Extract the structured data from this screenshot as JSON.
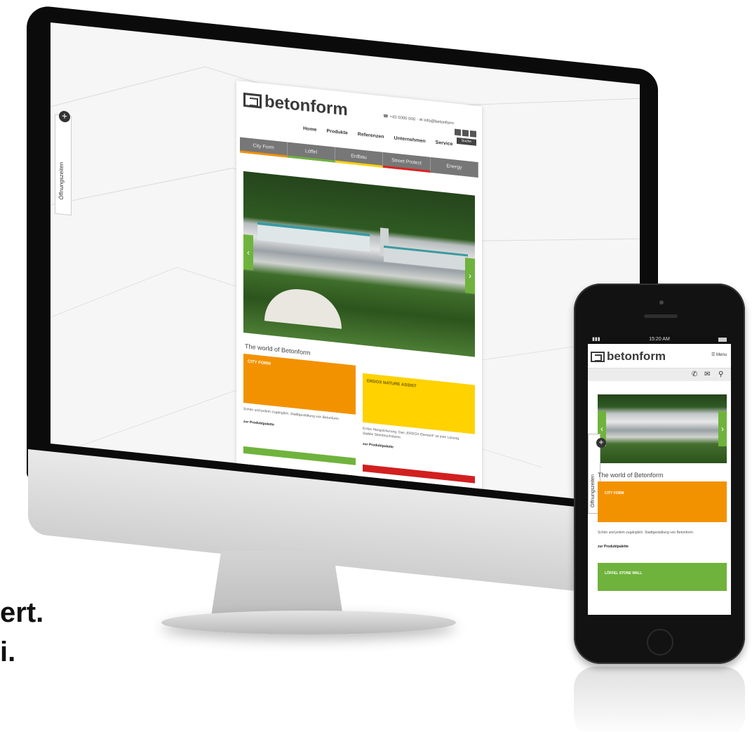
{
  "desktop": {
    "contact": "☎ +43 0000 000 · ✉ info@betonform",
    "search_label": "Suche",
    "brand": "betonform",
    "nav": [
      "Home",
      "Produkte",
      "Referenzen",
      "Unternehmen",
      "Service"
    ],
    "categories": [
      "City Form",
      "Löffel",
      "Erdbau",
      "Street Protect",
      "Energy"
    ],
    "oeffnungszeiten": "Öffnungszeiten",
    "section_title": "The world of Betonform",
    "tile1_label": "CITY FORM",
    "tile1_desc": "Schön und jedem zugänglich. Stadtgestaltung von Betonform.",
    "tile1_link": "zur Produktpalette",
    "tile2_label": "ERDOX NATURE ASSIST",
    "tile2_desc": "Erdox Hangsicherung. Das „ERDOX Element“ ist eine Lösung. Stabile Steinbruchsteine.",
    "tile2_link": "zur Produktpalette"
  },
  "mobile": {
    "time": "15:20 AM",
    "brand": "betonform",
    "menu": "Menu",
    "icons": [
      "phone-icon",
      "mail-icon",
      "location-icon"
    ],
    "section_title": "The world of Betonform",
    "oeffnungszeiten": "Öffnungszeiten",
    "tile1_label": "CITY FORM",
    "tile1_desc": "Schön und jedem zugänglich. Stadtgestaltung von Betonform.",
    "tile1_link": "zur Produktpalette",
    "tile2_label": "LÖFFEL STONE WALL"
  },
  "tagline": {
    "line1": "ert.",
    "line2": "i."
  }
}
